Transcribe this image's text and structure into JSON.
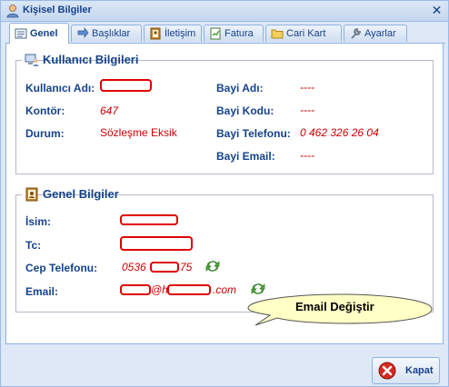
{
  "window": {
    "title": "Kişisel Bilgiler",
    "title_icon": "user-icon",
    "close_icon": "close-icon"
  },
  "tabs": [
    {
      "label": "Genel",
      "icon": "card-icon",
      "active": true
    },
    {
      "label": "Başlıklar",
      "icon": "arrow-icon"
    },
    {
      "label": "İletişim",
      "icon": "contact-book-icon"
    },
    {
      "label": "Fatura",
      "icon": "invoice-icon"
    },
    {
      "label": "Cari Kart",
      "icon": "folder-icon"
    },
    {
      "label": "Ayarlar",
      "icon": "wrench-icon"
    }
  ],
  "user_info": {
    "title": "Kullanıcı Bilgileri",
    "icon": "computer-user-icon",
    "kullanici_adi": {
      "label": "Kullanıcı Adı:",
      "value": ""
    },
    "kontor": {
      "label": "Kontör:",
      "value": "647"
    },
    "durum": {
      "label": "Durum:",
      "value": "Sözleşme Eksik"
    },
    "bayi_adi": {
      "label": "Bayi Adı:",
      "value": "----"
    },
    "bayi_kodu": {
      "label": "Bayi Kodu:",
      "value": "----"
    },
    "bayi_telefonu": {
      "label": "Bayi Telefonu:",
      "value": "0 462 326 26 04"
    },
    "bayi_email": {
      "label": "Bayi Email:",
      "value": "----"
    }
  },
  "general_info": {
    "title": "Genel Bilgiler",
    "icon": "address-book-icon",
    "isim": {
      "label": "İsim:",
      "value": ""
    },
    "tc": {
      "label": "Tc:",
      "value": ""
    },
    "cep": {
      "label": "Cep Telefonu:",
      "prefix": "0536",
      "suffix": "75"
    },
    "email": {
      "label": "Email:",
      "mid": "@h",
      "suffix": ".com"
    }
  },
  "tooltip": {
    "text": "Email Değiştir"
  },
  "footer": {
    "close_label": "Kapat",
    "close_icon": "cancel-icon"
  },
  "colors": {
    "label": "#15428b",
    "value": "#cc0000",
    "redaction": "#e00000",
    "accent": "#99bbe8"
  }
}
